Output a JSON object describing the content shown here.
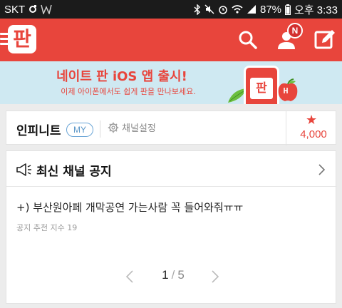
{
  "statusbar": {
    "carrier": "SKT",
    "battery": "87%",
    "time": "오후 3:33"
  },
  "header": {
    "logo_text": "판",
    "notification_badge": "N"
  },
  "banner": {
    "title": "네이트 판 iOS 앱 출시!",
    "subtitle": "이제 아이폰에서도 쉽게 판을 만나보세요.",
    "phone_text": "판"
  },
  "channel": {
    "name": "인피니트",
    "my_label": "MY",
    "settings_label": "채널설정",
    "star_count": "4,000"
  },
  "notice": {
    "title": "최신 채널 공지",
    "post_title": "+) 부산원아페 개막공연 가는사람 꼭 들어와줘ㅠㅠ",
    "post_meta": "공지 추천 지수 19"
  },
  "pager": {
    "current": "1",
    "separator": "/",
    "total": "5"
  },
  "colors": {
    "brand_red": "#e8453c",
    "banner_bg": "#cfe9f2",
    "statusbar_bg": "#1b1b1b",
    "my_blue": "#5b97c8"
  },
  "icons": [
    "menu-icon",
    "search-icon",
    "user-icon",
    "edit-icon",
    "gear-icon",
    "star-icon",
    "megaphone-icon",
    "chevron-right-icon",
    "chevron-left-icon"
  ]
}
